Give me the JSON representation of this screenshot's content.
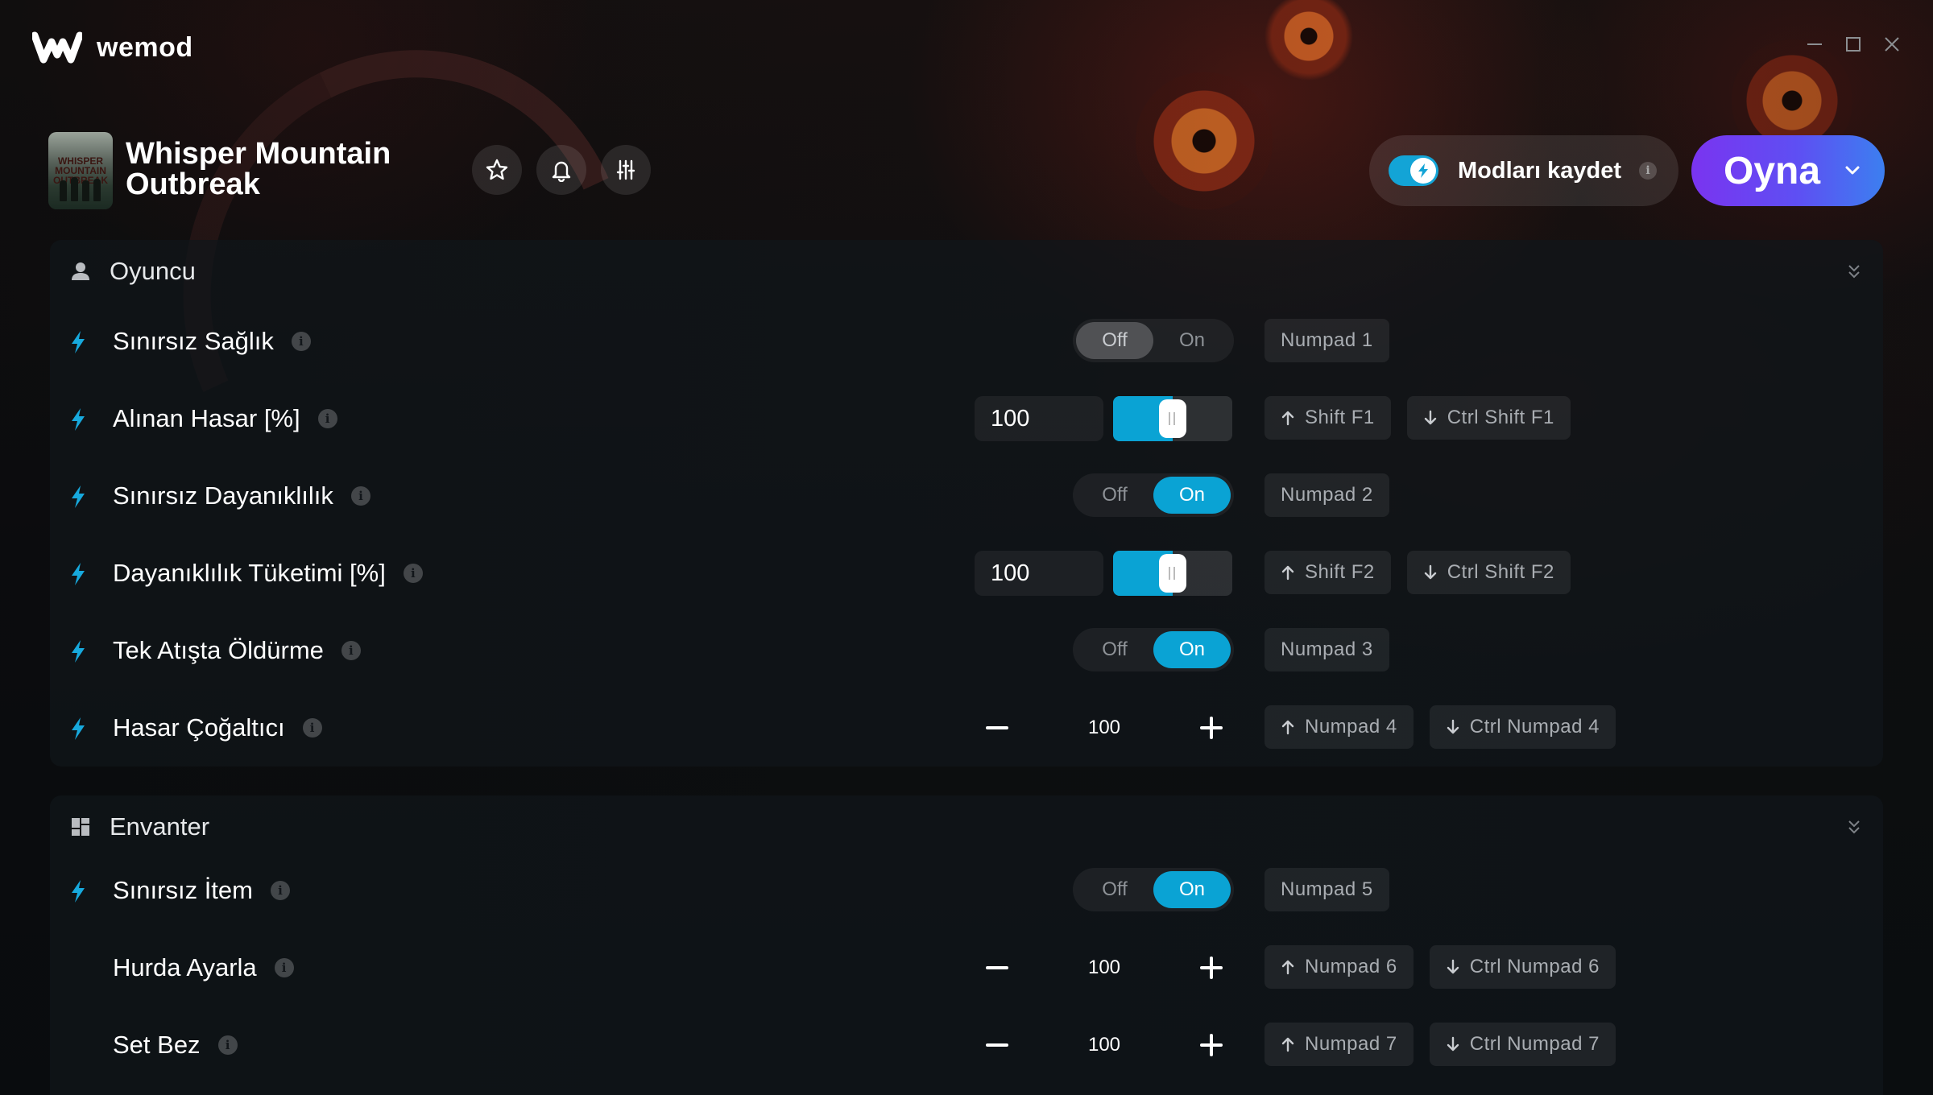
{
  "app": {
    "name": "wemod"
  },
  "game": {
    "title_line1": "Whisper Mountain",
    "title_line2": "Outbreak",
    "thumb_text": "WHISPER MOUNTAIN OUTBREAK"
  },
  "header": {
    "save_mods_label": "Modları kaydet",
    "save_mods_on": true,
    "play_label": "Oyna",
    "info": "i"
  },
  "sections": [
    {
      "title": "Oyuncu",
      "icon": "user-icon",
      "rows": [
        {
          "label": "Sınırsız Sağlık",
          "control": "toggle",
          "state": "Off",
          "off": "Off",
          "on": "On",
          "keys": [
            "Numpad 1"
          ]
        },
        {
          "label": "Alınan Hasar [%]",
          "control": "slider",
          "value": "100",
          "fraction": 0.5,
          "keys": [
            "Shift F1",
            "Ctrl Shift F1"
          ]
        },
        {
          "label": "Sınırsız Dayanıklılık",
          "control": "toggle",
          "state": "On",
          "off": "Off",
          "on": "On",
          "keys": [
            "Numpad 2"
          ]
        },
        {
          "label": "Dayanıklılık Tüketimi [%]",
          "control": "slider",
          "value": "100",
          "fraction": 0.5,
          "keys": [
            "Shift F2",
            "Ctrl Shift F2"
          ]
        },
        {
          "label": "Tek Atışta Öldürme",
          "control": "toggle",
          "state": "On",
          "off": "Off",
          "on": "On",
          "keys": [
            "Numpad 3"
          ]
        },
        {
          "label": "Hasar Çoğaltıcı",
          "control": "stepper",
          "value": "100",
          "keys": [
            "Numpad 4",
            "Ctrl Numpad 4"
          ]
        }
      ]
    },
    {
      "title": "Envanter",
      "icon": "grid-icon",
      "rows": [
        {
          "label": "Sınırsız İtem",
          "control": "toggle",
          "state": "On",
          "off": "Off",
          "on": "On",
          "keys": [
            "Numpad 5"
          ]
        },
        {
          "label": "Hurda Ayarla",
          "control": "stepper",
          "value": "100",
          "keys": [
            "Numpad 6",
            "Ctrl Numpad 6"
          ]
        },
        {
          "label": "Set Bez",
          "control": "stepper",
          "value": "100",
          "keys": [
            "Numpad 7",
            "Ctrl Numpad 7"
          ]
        }
      ]
    }
  ],
  "colors": {
    "accent": "#0aa3d4",
    "play_start": "#7a34f0",
    "play_end": "#3c7ff0"
  }
}
